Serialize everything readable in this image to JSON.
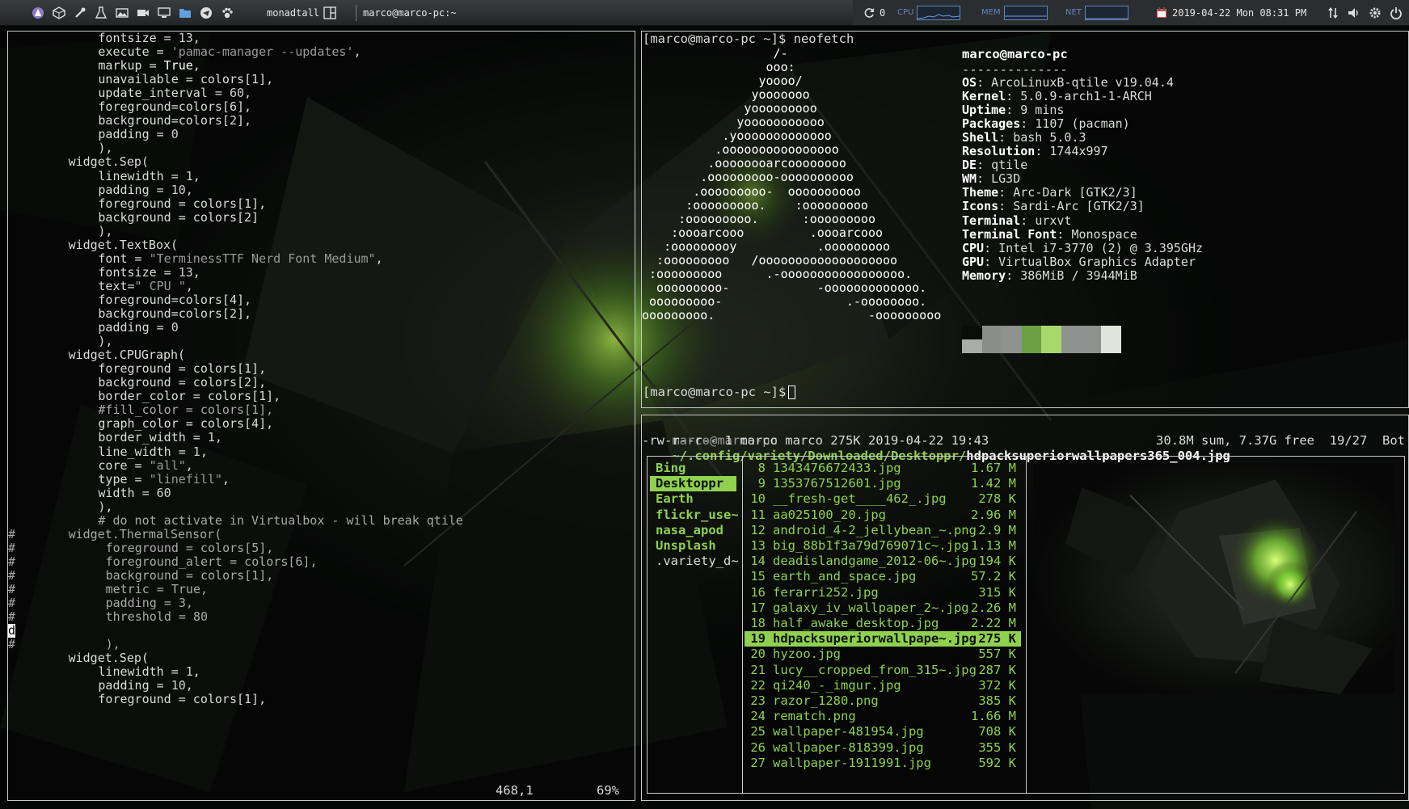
{
  "colors": {
    "accent": "#8fd14f",
    "string": "#9a9a9a",
    "number": "#cfcfcf",
    "comment": "#a9a9a9",
    "keyword": "#ffffff",
    "text": "#d9dcd8",
    "bar_blue": "#5e86c2",
    "calendar_red": "#d9534f"
  },
  "topbar": {
    "launcher_icons": [
      "arch-logo-icon",
      "box-icon",
      "eyedropper-icon",
      "flask-icon",
      "image-icon",
      "video-camera-icon",
      "monitor-icon",
      "folder-icon",
      "telegram-icon",
      "paw-icon"
    ],
    "layout_name": "monadtall",
    "window_title": "marco@marco-pc:~",
    "updates_count": "0",
    "cpu_label": "CPU",
    "mem_label": "MEM",
    "net_label": "NET",
    "clock": "2019-04-22 Mon 08:31 PM",
    "tray_icons": [
      "network-updown-icon",
      "volume-icon",
      "settings-gear-icon",
      "power-icon"
    ]
  },
  "editor": {
    "lines": [
      {
        "i": 12,
        "t": [
          [
            "fontsize = ",
            "t"
          ],
          [
            "13",
            "n"
          ],
          [
            ",",
            "t"
          ]
        ]
      },
      {
        "i": 12,
        "t": [
          [
            "execute = ",
            "t"
          ],
          [
            "'pamac-manager --updates'",
            "s"
          ],
          [
            ",",
            "t"
          ]
        ]
      },
      {
        "i": 12,
        "t": [
          [
            "markup = ",
            "t"
          ],
          [
            "True",
            "k"
          ],
          [
            ",",
            "t"
          ]
        ]
      },
      {
        "i": 12,
        "t": [
          [
            "unavailable = colors[1],",
            "t"
          ]
        ]
      },
      {
        "i": 12,
        "t": [
          [
            "update_interval = ",
            "t"
          ],
          [
            "60",
            "n"
          ],
          [
            ",",
            "t"
          ]
        ]
      },
      {
        "i": 12,
        "t": [
          [
            "foreground=colors[6],",
            "t"
          ]
        ]
      },
      {
        "i": 12,
        "t": [
          [
            "background=colors[2],",
            "t"
          ]
        ]
      },
      {
        "i": 12,
        "t": [
          [
            "padding = ",
            "t"
          ],
          [
            "0",
            "n"
          ]
        ]
      },
      {
        "i": 12,
        "t": [
          [
            "),",
            "t"
          ]
        ]
      },
      {
        "i": 8,
        "t": [
          [
            "widget.Sep(",
            "t"
          ]
        ]
      },
      {
        "i": 12,
        "t": [
          [
            "linewidth = ",
            "t"
          ],
          [
            "1",
            "n"
          ],
          [
            ",",
            "t"
          ]
        ]
      },
      {
        "i": 12,
        "t": [
          [
            "padding = ",
            "t"
          ],
          [
            "10",
            "n"
          ],
          [
            ",",
            "t"
          ]
        ]
      },
      {
        "i": 12,
        "t": [
          [
            "foreground = colors[1],",
            "t"
          ]
        ]
      },
      {
        "i": 12,
        "t": [
          [
            "background = colors[2]",
            "t"
          ]
        ]
      },
      {
        "i": 12,
        "t": [
          [
            "),",
            "t"
          ]
        ]
      },
      {
        "i": 8,
        "t": [
          [
            "widget.TextBox(",
            "t"
          ]
        ]
      },
      {
        "i": 12,
        "t": [
          [
            "font = ",
            "t"
          ],
          [
            "\"TerminessTTF Nerd Font Medium\"",
            "s"
          ],
          [
            ",",
            "t"
          ]
        ]
      },
      {
        "i": 12,
        "t": [
          [
            "fontsize = ",
            "t"
          ],
          [
            "13",
            "n"
          ],
          [
            ",",
            "t"
          ]
        ]
      },
      {
        "i": 12,
        "t": [
          [
            "text=",
            "t"
          ],
          [
            "\" CPU \"",
            "s"
          ],
          [
            ",",
            "t"
          ]
        ]
      },
      {
        "i": 12,
        "t": [
          [
            "foreground=colors[4],",
            "t"
          ]
        ]
      },
      {
        "i": 12,
        "t": [
          [
            "background=colors[2],",
            "t"
          ]
        ]
      },
      {
        "i": 12,
        "t": [
          [
            "padding = ",
            "t"
          ],
          [
            "0",
            "n"
          ]
        ]
      },
      {
        "i": 12,
        "t": [
          [
            "),",
            "t"
          ]
        ]
      },
      {
        "i": 8,
        "t": [
          [
            "widget.CPUGraph(",
            "t"
          ]
        ]
      },
      {
        "i": 12,
        "t": [
          [
            "foreground = colors[1],",
            "t"
          ]
        ]
      },
      {
        "i": 12,
        "t": [
          [
            "background = colors[2],",
            "t"
          ]
        ]
      },
      {
        "i": 12,
        "t": [
          [
            "border_color = colors[1],",
            "t"
          ]
        ]
      },
      {
        "i": 12,
        "t": [
          [
            "#fill_color = colors[1],",
            "c"
          ]
        ]
      },
      {
        "i": 12,
        "t": [
          [
            "graph_color = colors[4],",
            "t"
          ]
        ]
      },
      {
        "i": 12,
        "t": [
          [
            "border_width = ",
            "t"
          ],
          [
            "1",
            "n"
          ],
          [
            ",",
            "t"
          ]
        ]
      },
      {
        "i": 12,
        "t": [
          [
            "line_width = ",
            "t"
          ],
          [
            "1",
            "n"
          ],
          [
            ",",
            "t"
          ]
        ]
      },
      {
        "i": 12,
        "t": [
          [
            "core = ",
            "t"
          ],
          [
            "\"all\"",
            "s"
          ],
          [
            ",",
            "t"
          ]
        ]
      },
      {
        "i": 12,
        "t": [
          [
            "type = ",
            "t"
          ],
          [
            "\"linefill\"",
            "s"
          ],
          [
            ",",
            "t"
          ]
        ]
      },
      {
        "i": 12,
        "t": [
          [
            "width = ",
            "t"
          ],
          [
            "60",
            "n"
          ]
        ]
      },
      {
        "i": 12,
        "t": [
          [
            "),",
            "t"
          ]
        ]
      },
      {
        "i": 12,
        "t": [
          [
            "# do not activate in Virtualbox - will break qtile",
            "c"
          ]
        ]
      },
      {
        "p": "#",
        "i": 8,
        "t": [
          [
            "widget.ThermalSensor(",
            "c"
          ]
        ]
      },
      {
        "p": "#",
        "i": 13,
        "t": [
          [
            "foreground = colors[5],",
            "c"
          ]
        ]
      },
      {
        "p": "#",
        "i": 13,
        "t": [
          [
            "foreground_alert = colors[6],",
            "c"
          ]
        ]
      },
      {
        "p": "#",
        "i": 13,
        "t": [
          [
            "background = colors[1],",
            "c"
          ]
        ]
      },
      {
        "p": "#",
        "i": 13,
        "t": [
          [
            "metric = True,",
            "c"
          ]
        ]
      },
      {
        "p": "#",
        "i": 13,
        "t": [
          [
            "padding = 3,",
            "c"
          ]
        ]
      },
      {
        "p": "#",
        "i": 13,
        "t": [
          [
            "threshold = 80",
            "c"
          ]
        ]
      },
      {
        "p": "d",
        "cursor": true,
        "i": 0,
        "t": []
      },
      {
        "p": "#",
        "i": 13,
        "t": [
          [
            "),",
            "c"
          ]
        ]
      },
      {
        "i": 8,
        "t": [
          [
            "widget.Sep(",
            "t"
          ]
        ]
      },
      {
        "i": 12,
        "t": [
          [
            "linewidth = ",
            "t"
          ],
          [
            "1",
            "n"
          ],
          [
            ",",
            "t"
          ]
        ]
      },
      {
        "i": 12,
        "t": [
          [
            "padding = ",
            "t"
          ],
          [
            "10",
            "n"
          ],
          [
            ",",
            "t"
          ]
        ]
      },
      {
        "i": 12,
        "t": [
          [
            "foreground = colors[1],",
            "t"
          ]
        ]
      }
    ],
    "status_position": "468,1",
    "status_percent": "69%"
  },
  "neofetch": {
    "prompt_command": "[marco@marco-pc ~]$ neofetch",
    "prompt_final": "[marco@marco-pc ~]$ ",
    "art": [
      "                  /-",
      "                 ooo:",
      "                yoooo/",
      "               yooooooo",
      "              yooooooooo",
      "             yooooooooooo",
      "           .yooooooooooooo",
      "          .oooooooooooooooo",
      "         .oooooooarcoooooooo",
      "        .ooooooooo-oooooooooo",
      "       .ooooooooo-  oooooooooo",
      "      :ooooooooo.    :ooooooooo",
      "     :ooooooooo.      :ooooooooo",
      "    :oooarcooo         .oooarcooo",
      "   :ooooooooy           .ooooooooo",
      "  :ooooooooo   /ooooooooooooooooooo",
      " :ooooooooo      .-ooooooooooooooooo.",
      "  ooooooooo-            -ooooooooooooo.",
      " ooooooooo-                 .-oooooooo.",
      "ooooooooo.                     -ooooooooo"
    ],
    "user_host": "marco@marco-pc",
    "separator": "--------------",
    "info": [
      {
        "k": "OS",
        "v": "ArcoLinuxB-qtile v19.04.4"
      },
      {
        "k": "Kernel",
        "v": "5.0.9-arch1-1-ARCH"
      },
      {
        "k": "Uptime",
        "v": "9 mins"
      },
      {
        "k": "Packages",
        "v": "1107 (pacman)"
      },
      {
        "k": "Shell",
        "v": "bash 5.0.3"
      },
      {
        "k": "Resolution",
        "v": "1744x997"
      },
      {
        "k": "DE",
        "v": "qtile"
      },
      {
        "k": "WM",
        "v": "LG3D"
      },
      {
        "k": "Theme",
        "v": "Arc-Dark [GTK2/3]"
      },
      {
        "k": "Icons",
        "v": "Sardi-Arc [GTK2/3]"
      },
      {
        "k": "Terminal",
        "v": "urxvt"
      },
      {
        "k": "Terminal Font",
        "v": "Monospace"
      },
      {
        "k": "CPU",
        "v": "Intel i7-3770 (2) @ 3.395GHz"
      },
      {
        "k": "GPU",
        "v": "VirtualBox Graphics Adapter"
      },
      {
        "k": "Memory",
        "v": "386MiB / 3944MiB"
      }
    ],
    "swatches_top": [
      "#0a0d0a",
      "#8a8e88",
      "#8f918e",
      "#6ca043",
      "#a8d86b",
      "#8f918e",
      "#8f918e",
      "#dfe3dc"
    ],
    "swatches_bottom": [
      "#a9aca8",
      "#8a8e88",
      "#8f918e",
      "#6ca043",
      "#a8d86b",
      "#8f918e",
      "#8f918e",
      "#dfe3dc"
    ]
  },
  "ranger": {
    "user_host": "marco@marco-pc",
    "path_dim": "~/.config/variety/Downloaded/Desktoppr/",
    "path_file": "hdpacksuperiorwallpapers365_004.jpg",
    "file_info": "-rw-r--r-- 1 marco marco 275K 2019-04-22 19:43",
    "summary": "30.8M sum, 7.37G free  19/27  Bot",
    "dirs": [
      "Bing",
      "Desktoppr",
      "Earth",
      "flickr_use~",
      "nasa_apod",
      "Unsplash",
      ".variety_d~"
    ],
    "selected_dir": 1,
    "files": [
      {
        "n": "8",
        "name": "1343476672433.jpg",
        "size": "1.67 M"
      },
      {
        "n": "9",
        "name": "1353767512601.jpg",
        "size": "1.42 M"
      },
      {
        "n": "10",
        "name": "__fresh-get____462_.jpg",
        "size": "278 K"
      },
      {
        "n": "11",
        "name": "aa025100_20.jpg",
        "size": "2.96 M"
      },
      {
        "n": "12",
        "name": "android_4-2_jellybean_~.png",
        "size": "2.9 M"
      },
      {
        "n": "13",
        "name": "big_88b1f3a79d769071c~.jpg",
        "size": "1.13 M"
      },
      {
        "n": "14",
        "name": "deadislandgame_2012-06~.jpg",
        "size": "194 K"
      },
      {
        "n": "15",
        "name": "earth_and_space.jpg",
        "size": "57.2 K"
      },
      {
        "n": "16",
        "name": "ferarri252.jpg",
        "size": "315 K"
      },
      {
        "n": "17",
        "name": "galaxy_iv_wallpaper_2~.jpg",
        "size": "2.26 M"
      },
      {
        "n": "18",
        "name": "half_awake_desktop.jpg",
        "size": "2.22 M"
      },
      {
        "n": "19",
        "name": "hdpacksuperiorwallpape~.jpg",
        "size": "275 K"
      },
      {
        "n": "20",
        "name": "hyzoo.jpg",
        "size": "557 K"
      },
      {
        "n": "21",
        "name": "lucy__cropped_from_315~.jpg",
        "size": "287 K"
      },
      {
        "n": "22",
        "name": "qi240_-_imgur.jpg",
        "size": "372 K"
      },
      {
        "n": "23",
        "name": "razor_1280.png",
        "size": "385 K"
      },
      {
        "n": "24",
        "name": "rematch.png",
        "size": "1.66 M"
      },
      {
        "n": "25",
        "name": "wallpaper-481954.jpg",
        "size": "708 K"
      },
      {
        "n": "26",
        "name": "wallpaper-818399.jpg",
        "size": "355 K"
      },
      {
        "n": "27",
        "name": "wallpaper-1911991.jpg",
        "size": "592 K"
      }
    ],
    "selected_file": 11
  }
}
